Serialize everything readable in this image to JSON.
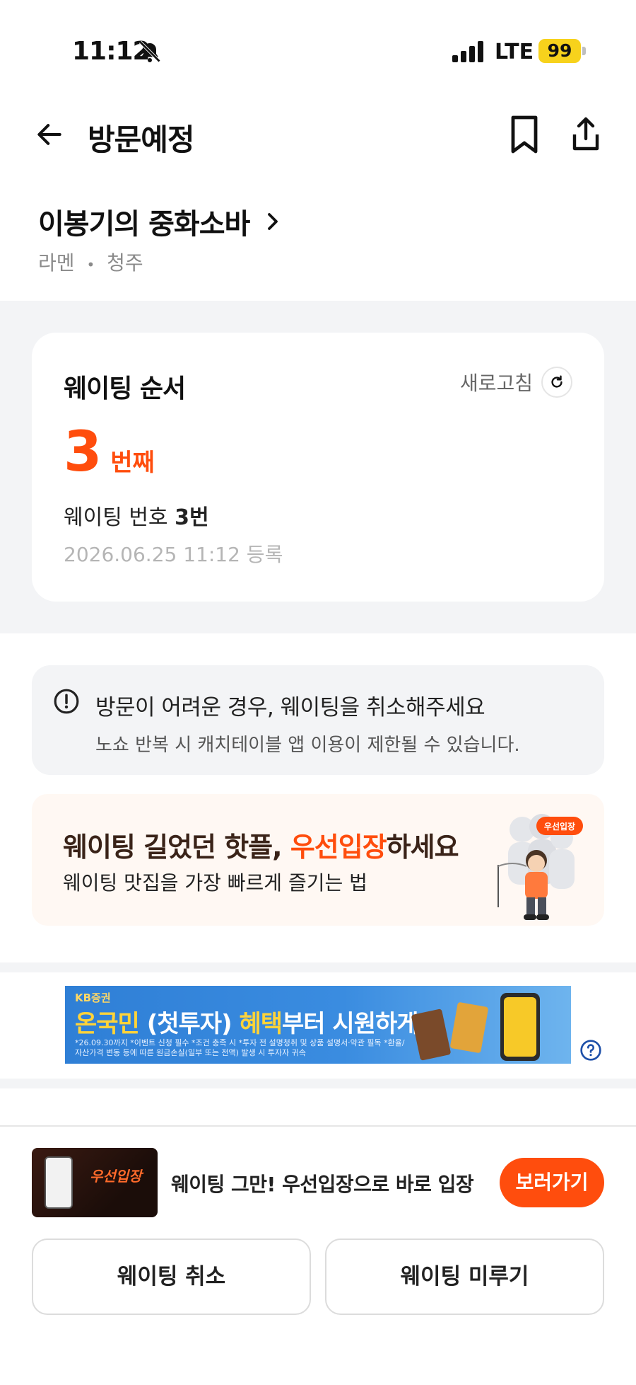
{
  "status_bar": {
    "time": "11:12",
    "network": "LTE",
    "battery": "99"
  },
  "header": {
    "title": "방문예정"
  },
  "store": {
    "name": "이봉기의 중화소바",
    "category": "라멘",
    "location": "청주",
    "separator": "•"
  },
  "waiting": {
    "title": "웨이팅 순서",
    "refresh_label": "새로고침",
    "order": "3",
    "order_unit": "번째",
    "number_label": "웨이팅 번호",
    "number_value": "3번",
    "registered_at": "2026.06.25 11:12 등록"
  },
  "notice": {
    "title": "방문이 어려운 경우, 웨이팅을 취소해주세요",
    "subtitle": "노쇼 반복 시 캐치테이블 앱 이용이 제한될 수 있습니다."
  },
  "promo": {
    "title_prefix": "웨이팅 길었던 핫플, ",
    "title_accent": "우선입장",
    "title_suffix": "하세요",
    "subtitle": "웨이팅 맛집을 가장 빠르게 즐기는 법",
    "bubble": "우선입장"
  },
  "ad": {
    "brand": "KB증권",
    "headline_1": "온국민 ",
    "headline_2": "(첫투자)",
    "headline_3": " 혜택",
    "headline_4": "부터 시원하게",
    "fine_print": "*26.09.30까지 *이벤트 신청 필수 *조건 충족 시 *투자 전 설명청취 및 상품 설명서·약관 필독 *환율/자산가격 변동 등에 따른 원금손실(일부 또는 전액) 발생 시 투자자 귀속"
  },
  "bottom_sheet": {
    "thumb_label": "우선입장",
    "message": "웨이팅 그만! 우선입장으로 바로 입장",
    "go_label": "보러가기",
    "cancel_label": "웨이팅 취소",
    "postpone_label": "웨이팅 미루기"
  },
  "colors": {
    "accent": "#ff4d0d",
    "battery": "#f7d21c",
    "background_gray": "#f3f4f6"
  }
}
